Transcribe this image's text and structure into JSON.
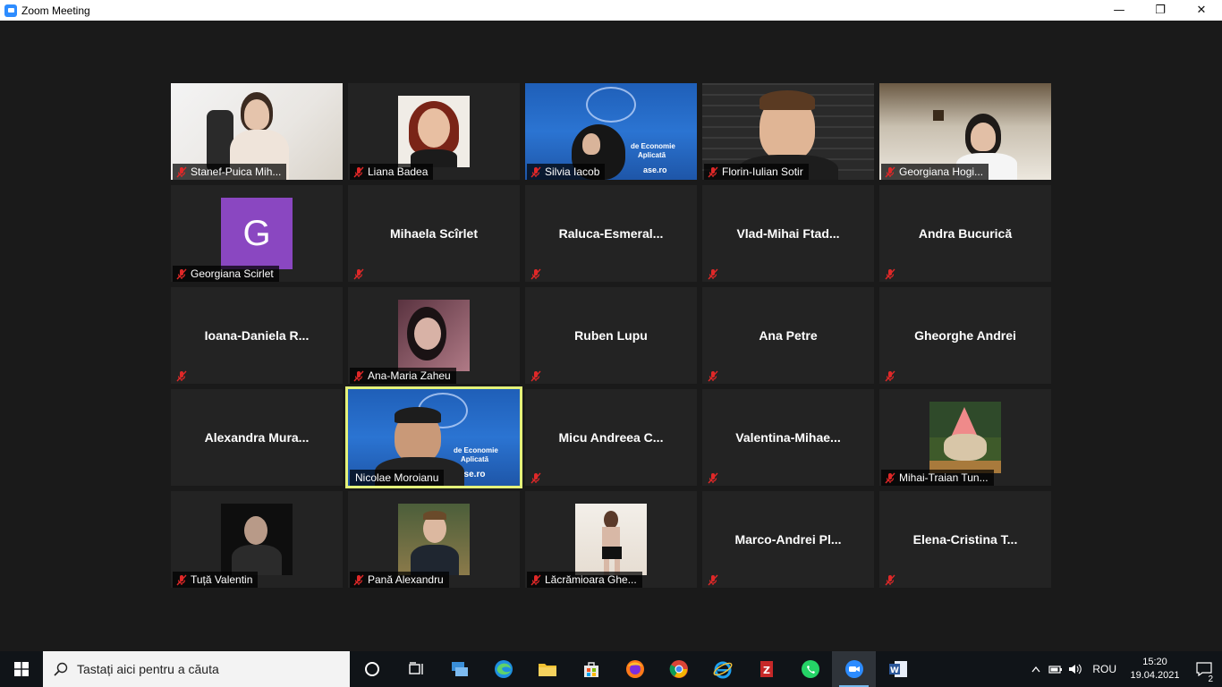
{
  "window": {
    "title": "Zoom Meeting",
    "minimize": "—",
    "restore": "❐",
    "close": "✕"
  },
  "participants": [
    {
      "name": "Stanef-Puica Mih...",
      "video": "room1"
    },
    {
      "name": "Liana Badea",
      "video": "photo"
    },
    {
      "name": "Silvia Iacob",
      "video": "ase"
    },
    {
      "name": "Florin-Iulian Sotir",
      "video": "room4"
    },
    {
      "name": "Georgiana Hogi...",
      "video": "room5"
    },
    {
      "name": "Georgiana Scirlet",
      "avatar_letter": "G"
    },
    {
      "name": "Mihaela Scîrlet",
      "video": "none"
    },
    {
      "name": "Raluca-Esmeral...",
      "video": "none"
    },
    {
      "name": "Vlad-Mihai  Ftad...",
      "video": "none"
    },
    {
      "name": "Andra Bucurică",
      "video": "none"
    },
    {
      "name": "Ioana-Daniela  R...",
      "video": "none"
    },
    {
      "name": "Ana-Maria Zaheu",
      "video": "photo"
    },
    {
      "name": "Ruben Lupu",
      "video": "none"
    },
    {
      "name": "Ana Petre",
      "video": "none"
    },
    {
      "name": "Gheorghe Andrei",
      "video": "none"
    },
    {
      "name": "Alexandra  Mura...",
      "video": "none"
    },
    {
      "name": "Nicolae Moroianu",
      "video": "ase",
      "speaking": true
    },
    {
      "name": "Micu  Andreea  C...",
      "video": "none"
    },
    {
      "name": "Valentina-Mihae...",
      "video": "none"
    },
    {
      "name": "Mihai-Traian Tun...",
      "video": "photo"
    },
    {
      "name": "Tuță Valentin",
      "video": "photo"
    },
    {
      "name": "Pană Alexandru",
      "video": "photo"
    },
    {
      "name": "Lăcrămioara Ghe...",
      "video": "photo"
    },
    {
      "name": "Marco-Andrei  Pl...",
      "video": "none"
    },
    {
      "name": "Elena-Cristina  T...",
      "video": "none"
    }
  ],
  "ase_overlay": {
    "line1": "de Economie",
    "line2": "Aplicată",
    "site": "ase.ro"
  },
  "taskbar": {
    "search_placeholder": "Tastați aici pentru a căuta",
    "language": "ROU",
    "time": "15:20",
    "date": "19.04.2021",
    "notifications": "2"
  },
  "colors": {
    "speaker_border": "#e4f27a",
    "tile_bg": "#232323",
    "mic_red": "#e02828"
  }
}
